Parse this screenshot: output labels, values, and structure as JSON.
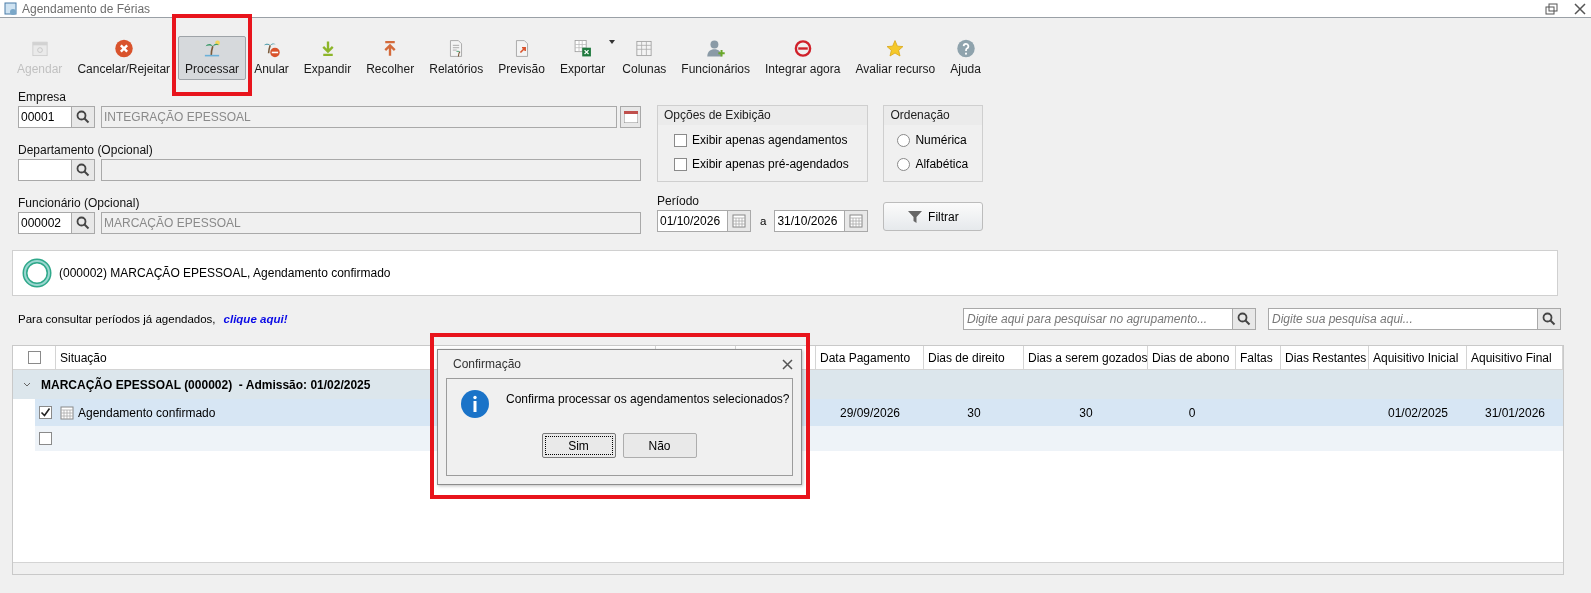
{
  "window": {
    "title": "Agendamento de Férias"
  },
  "toolbar": [
    {
      "label": "Agendar",
      "kind": "calendar",
      "disabled": true,
      "pressed": false
    },
    {
      "label": "Cancelar/Rejeitar",
      "kind": "cancel",
      "disabled": false,
      "pressed": false
    },
    {
      "label": "Processar",
      "kind": "palm",
      "disabled": false,
      "pressed": true
    },
    {
      "label": "Anular",
      "kind": "annul",
      "disabled": false,
      "pressed": false
    },
    {
      "label": "Expandir",
      "kind": "down",
      "disabled": false,
      "pressed": false
    },
    {
      "label": "Recolher",
      "kind": "up",
      "disabled": false,
      "pressed": false
    },
    {
      "label": "Relatórios",
      "kind": "report",
      "disabled": false,
      "pressed": false
    },
    {
      "label": "Previsão",
      "kind": "preview",
      "disabled": false,
      "pressed": false
    },
    {
      "label": "Exportar",
      "kind": "excel",
      "disabled": false,
      "pressed": false,
      "dropdown": true
    },
    {
      "label": "Colunas",
      "kind": "grid",
      "disabled": false,
      "pressed": false
    },
    {
      "label": "Funcionários",
      "kind": "user",
      "disabled": false,
      "pressed": false
    },
    {
      "label": "Integrar agora",
      "kind": "integrate",
      "disabled": false,
      "pressed": false
    },
    {
      "label": "Avaliar recurso",
      "kind": "star",
      "disabled": false,
      "pressed": false
    },
    {
      "label": "Ajuda",
      "kind": "help",
      "disabled": false,
      "pressed": false
    }
  ],
  "empresa": {
    "label": "Empresa",
    "code": "00001",
    "name": "INTEGRAÇÃO EPESSOAL"
  },
  "departamento": {
    "label": "Departamento (Opcional)"
  },
  "funcionario": {
    "label": "Funcionário (Opcional)",
    "code": "000002",
    "name": "MARCAÇÃO EPESSOAL"
  },
  "opcoes": {
    "title": "Opções de Exibição",
    "options": [
      {
        "label": "Exibir apenas agendamentos",
        "checked": false
      },
      {
        "label": "Exibir apenas pré-agendados",
        "checked": false
      }
    ]
  },
  "ordenacao": {
    "title": "Ordenação",
    "options": [
      {
        "label": "Numérica",
        "selected": false
      },
      {
        "label": "Alfabética",
        "selected": false
      }
    ]
  },
  "periodo": {
    "label": "Período",
    "start": "01/10/2026",
    "separator": "a",
    "end": "31/10/2026"
  },
  "filter_button": "Filtrar",
  "info_banner": "(000002) MARCAÇÃO EPESSOAL, Agendamento confirmado",
  "link_row": {
    "text": "Para consultar períodos já agendados,",
    "link": "clique aqui!"
  },
  "group_search": {
    "placeholder": "Digite aqui para pesquisar no agrupamento..."
  },
  "search": {
    "placeholder": "Digite sua pesquisa aqui..."
  },
  "table": {
    "columns": [
      "Situação",
      "Data Pagamento",
      "Dias de direito",
      "Dias a serem gozados",
      "Dias de abono",
      "Faltas",
      "Dias Restantes",
      "Aquisitivo Inicial",
      "Aquisitivo Final"
    ],
    "header_checked": false,
    "group": {
      "title": "MARCAÇÃO EPESSOAL (000002)  - Admissão: 01/02/2025",
      "expanded": true
    },
    "rows": [
      {
        "checked": true,
        "selected": true,
        "cells": [
          "Agendamento confirmado",
          "29/09/2026",
          "30",
          "30",
          "0",
          null,
          null,
          "01/02/2025",
          "31/01/2026"
        ]
      },
      {
        "checked": false,
        "selected": false
      }
    ]
  },
  "dialog": {
    "title": "Confirmação",
    "message": "Confirma processar os agendamentos selecionados?",
    "buttons": [
      {
        "label": "Sim",
        "focused": true
      },
      {
        "label": "Não",
        "focused": false
      }
    ]
  }
}
